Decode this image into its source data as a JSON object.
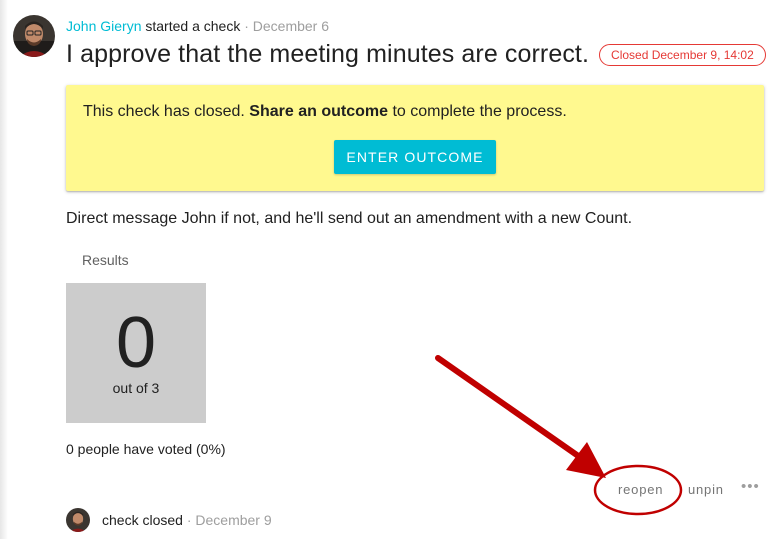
{
  "event": {
    "author": "John Gieryn",
    "action": "started a check",
    "separator": "·",
    "date": "December 6"
  },
  "poll": {
    "title": "I approve that the meeting minutes are correct.",
    "closed_badge": "Closed December 9, 14:02",
    "details": "Direct message John if not, and he'll send out an amendment with a new Count."
  },
  "notice": {
    "text_before": "This check has closed. ",
    "text_bold": "Share an outcome",
    "text_after": " to complete the process.",
    "button_label": "ENTER OUTCOME"
  },
  "results": {
    "label": "Results",
    "count": "0",
    "out_of": "out of 3",
    "voted_summary": "0 people have voted (0%)"
  },
  "actions": {
    "reopen": "reopen",
    "unpin": "unpin",
    "more": "•••"
  },
  "footer": {
    "text": "check closed",
    "separator": "·",
    "date": "December 9"
  },
  "colors": {
    "accent": "#00bcd4",
    "notice_bg": "#fff98f",
    "closed": "#e53935",
    "annotation": "#c00000"
  },
  "icons": {
    "avatar": "user-avatar-photo",
    "more": "more-horizontal-icon"
  }
}
